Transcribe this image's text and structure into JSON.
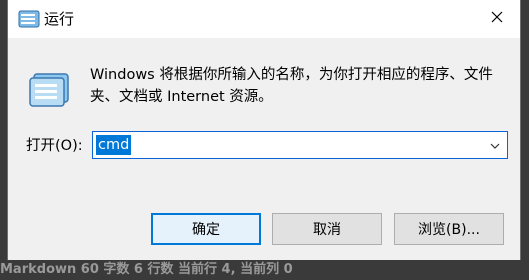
{
  "window": {
    "title": "运行",
    "title_icon": "run-icon",
    "close_icon": "close-icon"
  },
  "content": {
    "icon": "run-program-icon",
    "description": "Windows 将根据你所输入的名称，为你打开相应的程序、文件夹、文档或 Internet 资源。"
  },
  "open_field": {
    "label": "打开(O):",
    "value": "cmd",
    "dropdown_icon": "chevron-down-icon"
  },
  "buttons": {
    "ok": "确定",
    "cancel": "取消",
    "browse": "浏览(B)..."
  },
  "background_status": {
    "text": "Markdown   60 字数   6 行数   当前行 4, 当前列 0"
  },
  "colors": {
    "accent": "#0078d7",
    "selection": "#0078d7",
    "dialog_bg": "#f0f0f0"
  }
}
